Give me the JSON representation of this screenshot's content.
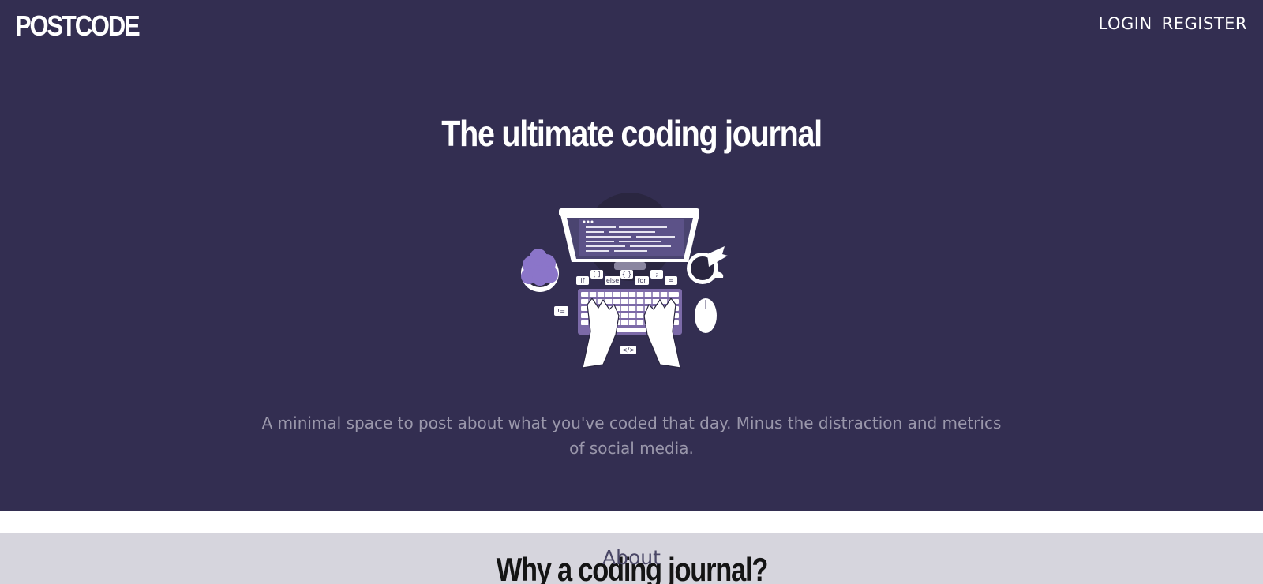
{
  "header": {
    "brand": "POSTCODE",
    "nav": {
      "login": "LOGIN",
      "register": "REGISTER"
    }
  },
  "hero": {
    "title": "The ultimate coding journal",
    "illustration_icon": "coder-at-desk-illustration",
    "code_bubbles": [
      "if",
      "[ ]",
      "else",
      "{ }",
      "for",
      ";",
      "=",
      "!=",
      "</>"
    ],
    "tagline": "A minimal space to post about what you've coded that day. Minus the distraction and metrics of social media."
  },
  "about": {
    "label": "About",
    "title": "Why a coding journal?"
  },
  "colors": {
    "hero_bg": "#332e51",
    "accent": "#7c6aa8",
    "about_bg": "#d6d5dd"
  }
}
